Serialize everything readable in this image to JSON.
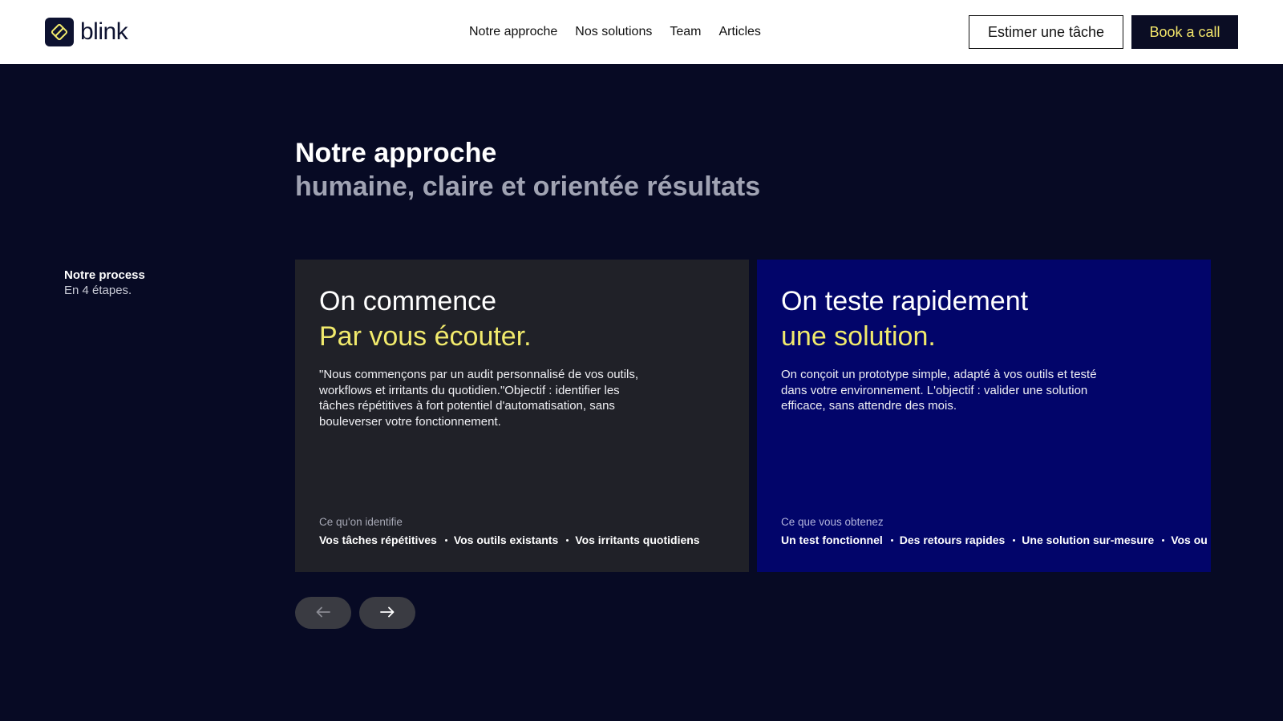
{
  "header": {
    "logo_text": "blink",
    "nav": [
      "Notre approche",
      "Nos solutions",
      "Team",
      "Articles"
    ],
    "estimate_button": "Estimer une tâche",
    "book_button": "Book a call"
  },
  "hero": {
    "title": "Notre approche",
    "subtitle": "humaine, claire et orientée résultats"
  },
  "process": {
    "title": "Notre process",
    "subtitle": "En 4 étapes."
  },
  "cards": [
    {
      "title": "On commence",
      "title_accent": "Par vous écouter.",
      "body": "\"Nous commençons par un audit personnalisé de vos outils, workflows et irritants du quotidien.\"Objectif : identifier les tâches répétitives à fort potentiel d'automatisation, sans bouleverser votre fonctionnement.",
      "footer_label": "Ce qu'on identifie",
      "tags": [
        "Vos tâches répétitives",
        "Vos outils existants",
        "Vos irritants quotidiens"
      ]
    },
    {
      "title": "On teste rapidement",
      "title_accent": "une solution.",
      "body": "On conçoit un prototype simple, adapté à vos outils et testé dans votre environnement. L'objectif : valider une solution efficace, sans attendre des mois.",
      "footer_label": "Ce que vous obtenez",
      "tags": [
        "Un test fonctionnel",
        "Des retours rapides",
        "Une solution sur-mesure",
        "Vos ou"
      ]
    }
  ],
  "icons": {
    "logo": "logo-mark-icon",
    "prev": "arrow-left-icon",
    "next": "arrow-right-icon"
  },
  "colors": {
    "background": "#070a24",
    "accent_yellow": "#f1ea6c",
    "card_dark": "#202128",
    "card_blue": "#02056a",
    "header_bg": "#ffffff"
  }
}
